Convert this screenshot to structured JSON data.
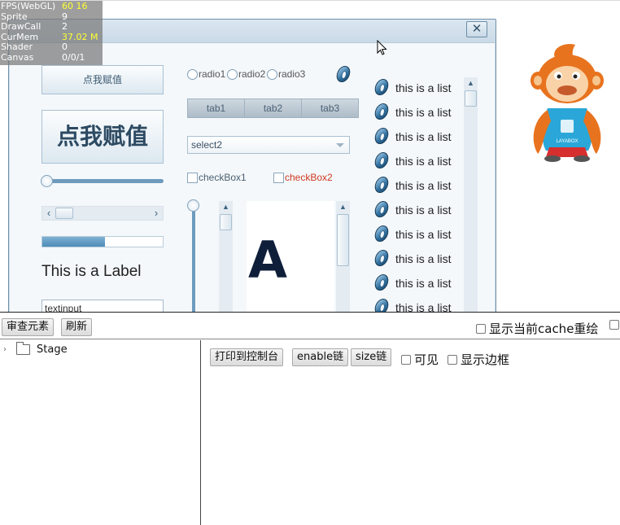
{
  "stats": {
    "rows": [
      {
        "label": "FPS(WebGL)",
        "value": "60 16",
        "highlight": true
      },
      {
        "label": "Sprite",
        "value": "9",
        "highlight": false
      },
      {
        "label": "DrawCall",
        "value": "2",
        "highlight": false
      },
      {
        "label": "CurMem",
        "value": "37.02 M",
        "highlight": true
      },
      {
        "label": "Shader",
        "value": "0",
        "highlight": false
      },
      {
        "label": "Canvas",
        "value": "0/0/1",
        "highlight": false
      }
    ]
  },
  "window": {
    "close_label": "✕",
    "button_small_label": "点我赋值",
    "button_big_label": "点我赋值",
    "hslider_value": 0,
    "hscroll": {
      "left_arrow": "‹",
      "right_arrow": "›"
    },
    "progress_value": 0.52,
    "label_text": "This is a Label",
    "textinput_value": "textinput",
    "radios": [
      "radio1",
      "radio2",
      "radio3"
    ],
    "tabs": [
      "tab1",
      "tab2",
      "tab3"
    ],
    "select_value": "select2",
    "checkboxes": [
      {
        "label": "checkBox1",
        "color": "#4a5f70"
      },
      {
        "label": "checkBox2",
        "color": "#d0391f"
      }
    ],
    "panel_letter": "A",
    "list_items": [
      "this is a list",
      "this is a list",
      "this is a list",
      "this is a list",
      "this is a list",
      "this is a list",
      "this is a list",
      "this is a list",
      "this is a list",
      "this is a list"
    ]
  },
  "mascot": {
    "badge_text": "LAYABOX"
  },
  "toolbar": {
    "inspect_label": "审查元素",
    "refresh_label": "刷新",
    "cache_redraw_label": "显示当前cache重绘"
  },
  "tree": {
    "root_label": "Stage"
  },
  "props": {
    "print_label": "打印到控制台",
    "enable_chain_label": "enable链",
    "size_chain_label": "size链",
    "visible_label": "可见",
    "show_border_label": "显示边框"
  },
  "colors": {
    "accent": "#6e9bbd",
    "window_border": "#6f8fa8"
  }
}
